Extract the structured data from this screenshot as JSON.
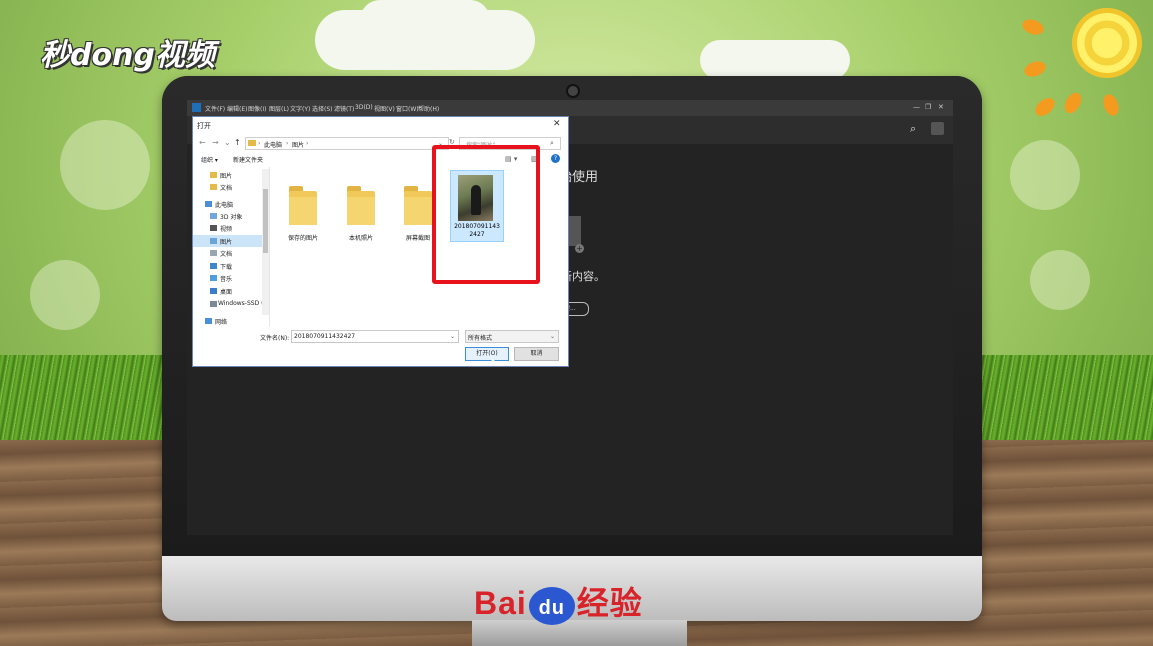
{
  "watermark": {
    "top_left_logo": "秒dong视频",
    "brand_logo_text": "Bai",
    "brand_logo_paw": "du",
    "brand_logo_suffix": "经验"
  },
  "photoshop": {
    "menu": [
      "文件(F)",
      "编辑(E)",
      "图像(I)",
      "图层(L)",
      "文字(Y)",
      "选择(S)",
      "滤镜(T)",
      "3D(D)",
      "视图(V)",
      "窗口(W)",
      "帮助(H)"
    ],
    "window_controls": [
      "—",
      "❐",
      "✕"
    ],
    "bg_heading": "始使用",
    "bg_sub": "新内容。",
    "bg_button": "建..."
  },
  "dialog": {
    "title": "打开",
    "breadcrumb": [
      "此电脑",
      "图片"
    ],
    "search_placeholder": "搜索\"图片\"",
    "toolbar": {
      "organize": "组织 ▾",
      "new_folder": "新建文件夹",
      "help": "?"
    },
    "nav_items": [
      {
        "label": "图片",
        "type": "folder"
      },
      {
        "label": "文档",
        "type": "folder"
      },
      {
        "label": "此电脑",
        "type": "pc"
      },
      {
        "label": "3D 对象",
        "type": "obj3d"
      },
      {
        "label": "视频",
        "type": "video"
      },
      {
        "label": "图片",
        "type": "pictures",
        "selected": true
      },
      {
        "label": "文档",
        "type": "docs"
      },
      {
        "label": "下载",
        "type": "download"
      },
      {
        "label": "音乐",
        "type": "music"
      },
      {
        "label": "桌面",
        "type": "desktop"
      },
      {
        "label": "Windows-SSD (",
        "type": "drive"
      },
      {
        "label": "网络",
        "type": "network"
      }
    ],
    "folders": [
      "保存的图片",
      "本机照片",
      "屏幕截图"
    ],
    "selected_file": {
      "name_line1": "201807091143",
      "name_line2": "2427"
    },
    "filename_label": "文件名(N):",
    "filename_value": "2018070911432427",
    "filetype_value": "所有格式",
    "open_button": "打开(O)",
    "cancel_button": "取消"
  },
  "colors": {
    "highlight_red": "#e8121d",
    "selection_blue": "#cce8ff",
    "folder_yellow": "#f0c95a"
  }
}
